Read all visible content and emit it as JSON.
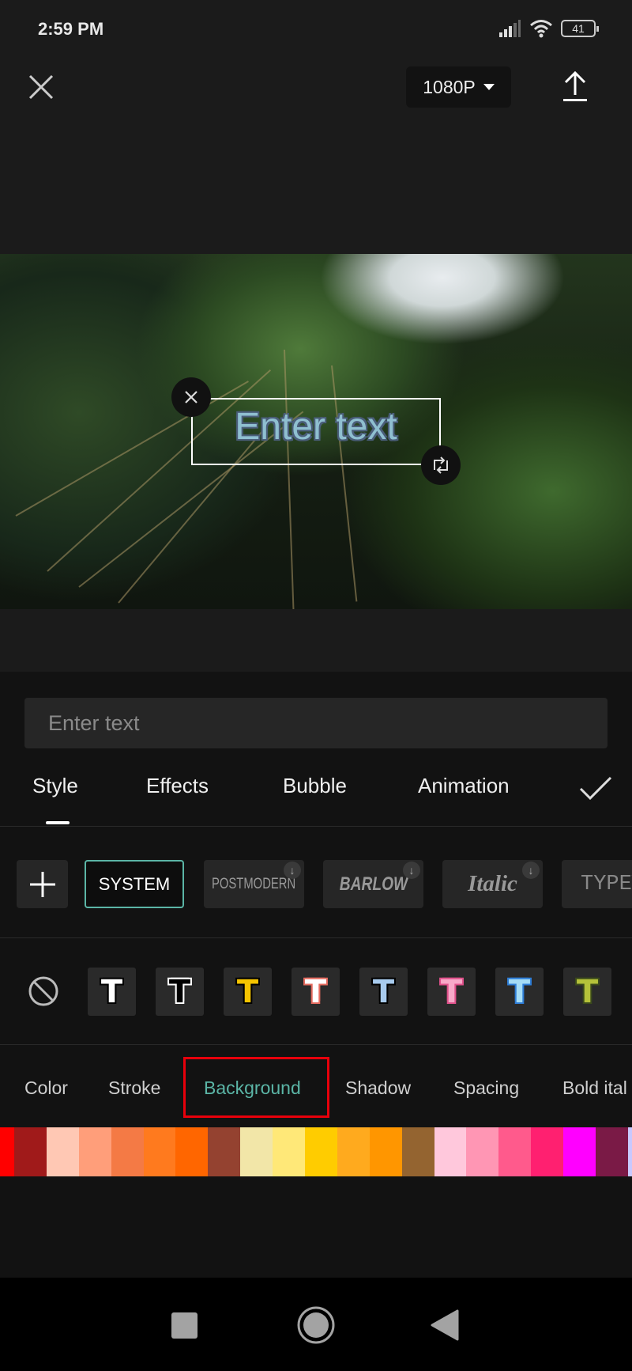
{
  "status_bar": {
    "time": "2:59 PM",
    "battery": "41",
    "icons": [
      "signal-icon",
      "wifi-icon",
      "battery-icon"
    ]
  },
  "top_bar": {
    "close_icon": "close-icon",
    "resolution": "1080P",
    "export_icon": "upload-icon"
  },
  "preview": {
    "overlay_text": "Enter text",
    "delete_icon": "close-icon",
    "rotate_icon": "rotate-scale-icon"
  },
  "editor": {
    "input_placeholder": "Enter text",
    "tabs": [
      {
        "label": "Style",
        "active": true
      },
      {
        "label": "Effects"
      },
      {
        "label": "Bubble"
      },
      {
        "label": "Animation"
      }
    ],
    "confirm_icon": "check-icon",
    "fonts": [
      {
        "label": "SYSTEM",
        "selected": true
      },
      {
        "label": "POSTMODERN"
      },
      {
        "label": "BARLOW"
      },
      {
        "label": "Italic"
      },
      {
        "label": "TYPEWRITER"
      }
    ],
    "text_styles": [
      {
        "fill": "#ffffff",
        "stroke": "#000000"
      },
      {
        "fill": "#000000",
        "stroke": "#ffffff"
      },
      {
        "fill": "#f5c400",
        "stroke": "#000000"
      },
      {
        "fill": "#ffffff",
        "stroke": "#e46a5e"
      },
      {
        "fill": "#a8cbee",
        "stroke": "#000000"
      },
      {
        "fill": "#f7a9c8",
        "stroke": "#e0518b"
      },
      {
        "fill": "#a5dcf5",
        "stroke": "#2e7dd6"
      },
      {
        "fill": "#b5c23a",
        "stroke": "#3b4a1c"
      }
    ],
    "sub_tabs": [
      {
        "label": "Color"
      },
      {
        "label": "Stroke"
      },
      {
        "label": "Background",
        "active": true
      },
      {
        "label": "Shadow"
      },
      {
        "label": "Spacing"
      },
      {
        "label": "Bold ital"
      }
    ],
    "accent_color": "#5bb5a6",
    "highlight_color": "#e8000b",
    "swatches": [
      "#ff0000",
      "#a01a1a",
      "#ffc8b4",
      "#ff9e7a",
      "#f47a45",
      "#ff7a1e",
      "#ff6600",
      "#944230",
      "#f2e6a8",
      "#ffe878",
      "#ffcc00",
      "#ffaa1e",
      "#ff9600",
      "#946430",
      "#ffc8dc",
      "#ff96b4",
      "#ff5a8c",
      "#ff2070",
      "#ff00ff",
      "#7a1a46",
      "#c8c8ff"
    ]
  },
  "nav_bar": {
    "icons": [
      "recents-icon",
      "home-icon",
      "back-icon"
    ]
  }
}
